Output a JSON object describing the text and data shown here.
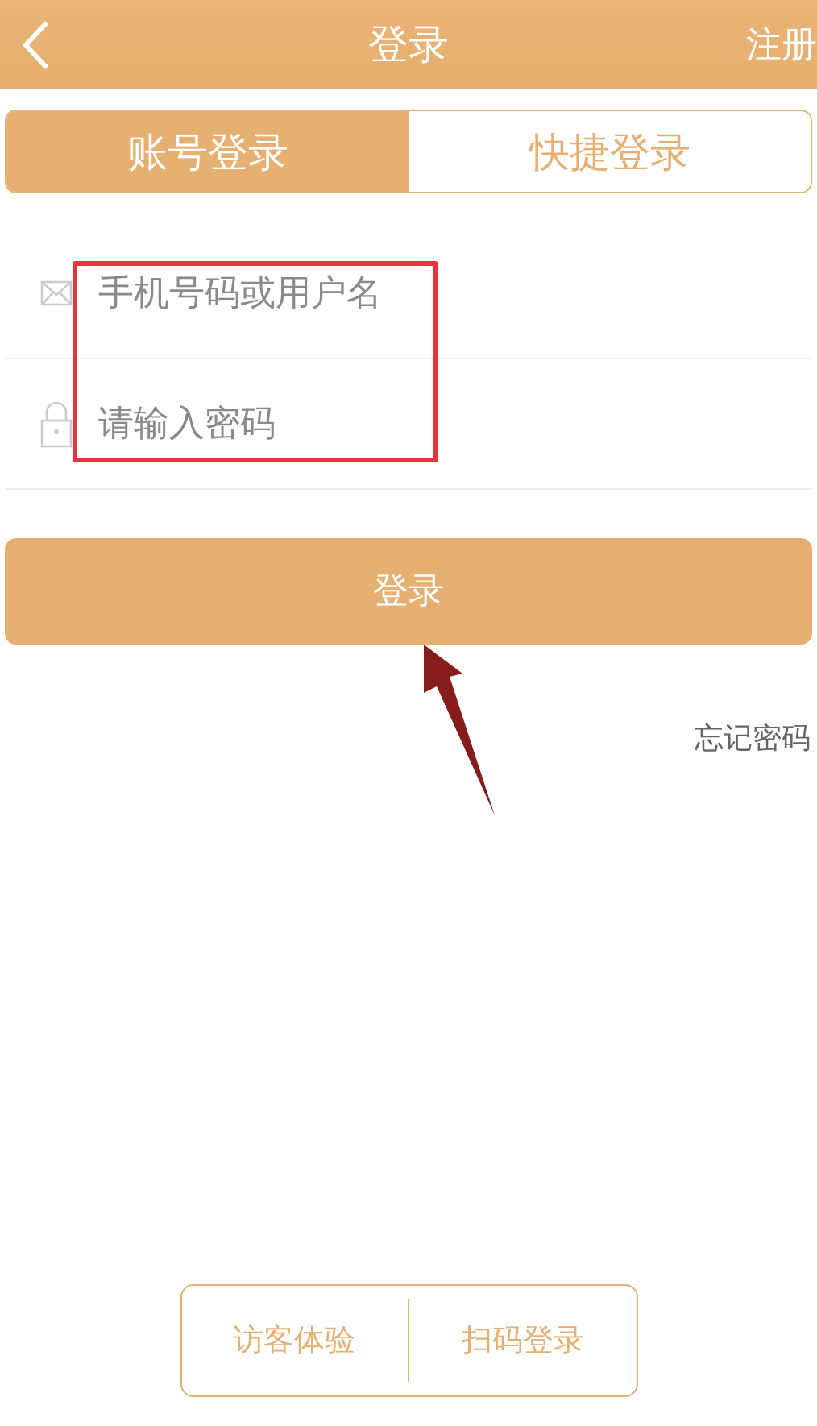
{
  "header": {
    "title": "登录",
    "action": "注册"
  },
  "tabs": [
    {
      "label": "账号登录",
      "selected": true
    },
    {
      "label": "快捷登录",
      "selected": false
    }
  ],
  "fields": [
    {
      "kind": "account",
      "placeholder": "手机号码或用户名"
    },
    {
      "kind": "password",
      "placeholder": "请输入密码"
    }
  ],
  "login_button": "登录",
  "forgot_link": "忘记密码",
  "bottom_actions": [
    "访客体验",
    "扫码登录"
  ]
}
